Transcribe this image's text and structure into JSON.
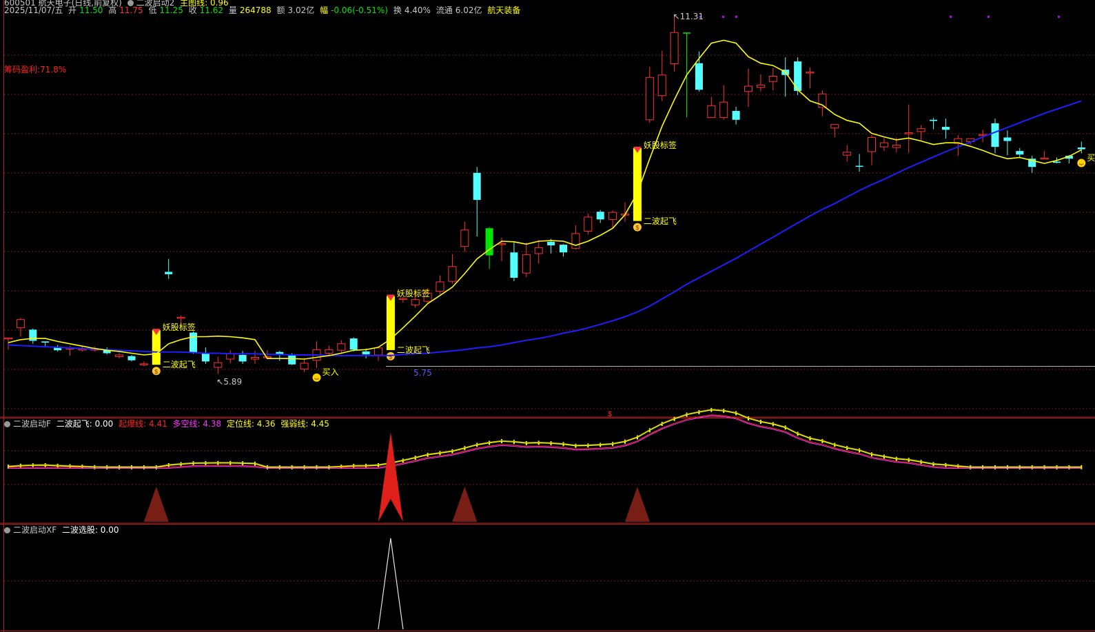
{
  "header": {
    "stock_code_name": "600501 航天电子(日线,前复权)",
    "indicator_name": "二波启动2",
    "guide_line": "主图线: 0.96",
    "date": "2025/11/07/五",
    "open_label": "开",
    "open": "11.50",
    "high_label": "高",
    "high": "11.75",
    "low_label": "低",
    "low": "11.25",
    "close_label": "收",
    "close": "11.62",
    "volume_label": "量",
    "volume": "264788",
    "amount_label": "额",
    "amount": "3.02亿",
    "change_label": "幅",
    "change": "-0.06(-0.51%)",
    "turnover_label": "换",
    "turnover": "4.40%",
    "float_label": "流通",
    "float_cap": "6.02亿",
    "sector": "航天装备"
  },
  "chip_profit": "筹码盈利:71.8%",
  "annotations": {
    "high_value": "11.31",
    "low_value": "5.89",
    "level_value": "5.75",
    "demon_tag": "妖股标签",
    "second_wave": "二波起飞",
    "buy": "买入",
    "buy_right": "买入"
  },
  "panel2": {
    "name": "二波启动F",
    "s1": "二波起飞: 0.00",
    "s2": "起爆线: 4.41",
    "s3": "多空线: 4.38",
    "s4": "定位线: 4.36",
    "s5": "强弱线: 4.45"
  },
  "panel3": {
    "name": "二波启动XF",
    "s1": "二波选股: 0.00"
  },
  "colors": {
    "up": "#ff3232",
    "down": "#54ffff",
    "signal": "#ffff00",
    "ma_fast": "#ffff00",
    "ma_slow": "#1e1eff",
    "limit_down": "#00e600",
    "grid": "#781e1e",
    "panel_border": "#b41e1e"
  },
  "chart_data": {
    "type": "candlestick",
    "candles": [
      [
        5.96,
        5.96,
        5.76,
        5.86
      ],
      [
        6.13,
        6.27,
        5.98,
        6.3
      ],
      [
        6.1,
        5.91,
        5.86,
        6.12
      ],
      [
        5.9,
        5.88,
        5.81,
        5.9
      ],
      [
        5.81,
        5.75,
        5.73,
        5.84
      ],
      [
        5.77,
        5.79,
        5.66,
        5.82
      ],
      [
        5.77,
        5.77,
        5.73,
        5.82
      ],
      [
        5.77,
        5.77,
        5.73,
        5.81
      ],
      [
        5.75,
        5.7,
        5.68,
        5.8
      ],
      [
        5.64,
        5.67,
        5.61,
        5.7
      ],
      [
        5.65,
        5.58,
        5.56,
        5.67
      ],
      [
        5.52,
        5.52,
        5.48,
        5.56
      ],
      [
        5.6,
        6.0,
        5.55,
        6.02
      ],
      [
        7.08,
        7.04,
        6.96,
        7.3
      ],
      [
        6.3,
        6.31,
        6.16,
        6.34
      ],
      [
        6.05,
        5.71,
        5.69,
        6.07
      ],
      [
        5.71,
        5.56,
        5.52,
        5.8
      ],
      [
        5.46,
        5.54,
        5.35,
        5.64
      ],
      [
        5.6,
        5.69,
        5.53,
        5.75
      ],
      [
        5.67,
        5.56,
        5.52,
        5.74
      ],
      [
        5.6,
        5.63,
        5.52,
        5.74
      ],
      [
        5.64,
        5.64,
        5.6,
        5.75
      ],
      [
        5.72,
        5.67,
        5.57,
        5.74
      ],
      [
        5.66,
        5.51,
        5.5,
        5.7
      ],
      [
        5.43,
        5.53,
        5.38,
        5.62
      ],
      [
        5.58,
        5.76,
        5.45,
        5.9
      ],
      [
        5.7,
        5.76,
        5.66,
        5.83
      ],
      [
        5.75,
        5.86,
        5.7,
        5.92
      ],
      [
        5.95,
        5.76,
        5.73,
        5.97
      ],
      [
        5.73,
        5.68,
        5.61,
        5.78
      ],
      [
        5.67,
        5.79,
        5.57,
        5.8
      ],
      [
        5.9,
        6.52,
        5.8,
        6.6
      ],
      [
        6.62,
        6.63,
        6.56,
        6.65
      ],
      [
        6.52,
        6.61,
        6.47,
        6.75
      ],
      [
        6.58,
        6.72,
        6.56,
        6.8
      ],
      [
        6.75,
        6.91,
        6.7,
        7.02
      ],
      [
        6.92,
        7.17,
        6.88,
        7.38
      ],
      [
        7.51,
        7.79,
        7.42,
        7.93
      ],
      [
        8.76,
        8.3,
        7.68,
        8.86
      ],
      [
        7.82,
        7.36,
        7.13,
        7.84
      ],
      [
        7.56,
        7.56,
        7.26,
        7.66
      ],
      [
        7.41,
        6.98,
        6.92,
        7.58
      ],
      [
        7.06,
        7.37,
        6.99,
        7.58
      ],
      [
        7.39,
        7.49,
        7.22,
        7.62
      ],
      [
        7.59,
        7.53,
        7.39,
        7.64
      ],
      [
        7.54,
        7.41,
        7.34,
        7.55
      ],
      [
        7.48,
        7.73,
        7.46,
        7.87
      ],
      [
        7.77,
        8.01,
        7.71,
        8.07
      ],
      [
        8.1,
        7.97,
        7.91,
        8.13
      ],
      [
        7.97,
        8.09,
        7.83,
        8.12
      ],
      [
        8.05,
        8.06,
        7.93,
        8.26
      ],
      [
        9.03,
        8.2,
        7.99,
        9.11
      ],
      [
        9.66,
        10.38,
        9.61,
        10.56
      ],
      [
        10.07,
        10.42,
        9.98,
        10.83
      ],
      [
        10.61,
        11.14,
        10.48,
        11.45
      ],
      [
        11.14,
        11.14,
        9.7,
        11.14
      ],
      [
        10.62,
        10.17,
        10.14,
        10.82
      ],
      [
        9.7,
        9.9,
        9.76,
        10.05
      ],
      [
        9.7,
        9.96,
        9.66,
        10.25
      ],
      [
        9.81,
        9.66,
        9.58,
        9.88
      ],
      [
        10.14,
        10.23,
        9.88,
        10.53
      ],
      [
        10.21,
        10.25,
        10.14,
        10.43
      ],
      [
        10.31,
        10.4,
        10.16,
        10.54
      ],
      [
        10.51,
        10.42,
        10.05,
        10.72
      ],
      [
        10.65,
        10.15,
        10.08,
        10.72
      ],
      [
        10.47,
        10.47,
        10.19,
        10.55
      ],
      [
        9.87,
        10.1,
        9.72,
        10.16
      ],
      [
        9.52,
        9.58,
        9.36,
        9.59
      ],
      [
        9.06,
        9.11,
        8.95,
        9.23
      ],
      [
        8.88,
        8.87,
        8.78,
        9.08
      ],
      [
        9.12,
        9.36,
        8.89,
        9.4
      ],
      [
        9.2,
        9.27,
        9.13,
        9.35
      ],
      [
        9.19,
        9.23,
        9.11,
        9.36
      ],
      [
        9.44,
        9.44,
        9.1,
        9.92
      ],
      [
        9.46,
        9.51,
        9.29,
        9.57
      ],
      [
        9.66,
        9.64,
        9.5,
        9.69
      ],
      [
        9.54,
        9.49,
        9.34,
        9.68
      ],
      [
        9.26,
        9.34,
        9.05,
        9.4
      ],
      [
        9.29,
        9.34,
        9.24,
        9.32
      ],
      [
        9.41,
        9.41,
        9.28,
        9.49
      ],
      [
        9.6,
        9.2,
        9.09,
        9.68
      ],
      [
        9.36,
        9.3,
        9.06,
        9.48
      ],
      [
        9.13,
        9.07,
        9.02,
        9.18
      ],
      [
        9.0,
        8.86,
        8.76,
        9.05
      ],
      [
        9.01,
        9.01,
        8.99,
        9.13
      ],
      [
        8.95,
        8.93,
        8.92,
        9.02
      ],
      [
        9.05,
        9.0,
        8.92,
        9.06
      ],
      [
        9.19,
        9.16,
        9.09,
        9.29
      ]
    ],
    "ma_fast_label": "MA5",
    "ma_slow_label": "MA60",
    "ma_fast": [
      5.88,
      5.93,
      5.95,
      5.95,
      5.9,
      5.86,
      5.82,
      5.78,
      5.75,
      5.73,
      5.7,
      5.67,
      5.69,
      5.86,
      5.93,
      5.98,
      5.98,
      5.99,
      5.98,
      5.96,
      5.93,
      5.61,
      5.61,
      5.61,
      5.6,
      5.63,
      5.66,
      5.7,
      5.75,
      5.76,
      5.8,
      5.94,
      6.13,
      6.33,
      6.54,
      6.68,
      6.82,
      7.05,
      7.3,
      7.46,
      7.6,
      7.59,
      7.55,
      7.6,
      7.61,
      7.6,
      7.53,
      7.6,
      7.7,
      7.82,
      8.05,
      8.42,
      9.0,
      9.55,
      10.0,
      10.42,
      10.7,
      10.96,
      11.01,
      10.96,
      10.73,
      10.62,
      10.58,
      10.47,
      10.17,
      9.98,
      9.91,
      9.75,
      9.65,
      9.6,
      9.43,
      9.37,
      9.32,
      9.35,
      9.3,
      9.24,
      9.27,
      9.27,
      9.21,
      9.14,
      9.06,
      9.0,
      9.02,
      8.97,
      8.92,
      8.97,
      9.04,
      9.15
    ],
    "ma_slow": [
      5.84,
      5.83,
      5.82,
      5.81,
      5.8,
      5.79,
      5.78,
      5.77,
      5.76,
      5.75,
      5.74,
      5.73,
      5.72,
      5.72,
      5.72,
      5.71,
      5.7,
      5.7,
      5.69,
      5.69,
      5.69,
      5.68,
      5.68,
      5.67,
      5.67,
      5.67,
      5.66,
      5.66,
      5.66,
      5.66,
      5.66,
      5.66,
      5.68,
      5.69,
      5.7,
      5.72,
      5.74,
      5.76,
      5.79,
      5.81,
      5.84,
      5.88,
      5.92,
      5.95,
      5.99,
      6.04,
      6.08,
      6.13,
      6.19,
      6.25,
      6.32,
      6.4,
      6.5,
      6.62,
      6.74,
      6.87,
      6.98,
      7.09,
      7.2,
      7.31,
      7.43,
      7.55,
      7.67,
      7.79,
      7.91,
      8.03,
      8.14,
      8.24,
      8.35,
      8.46,
      8.56,
      8.65,
      8.75,
      8.85,
      8.94,
      9.03,
      9.12,
      9.2,
      9.28,
      9.37,
      9.45,
      9.53,
      9.61,
      9.69,
      9.77,
      9.84,
      9.91,
      9.98
    ],
    "demon_signal_bars": [
      12,
      31,
      51
    ],
    "buy_bars": [
      25,
      87
    ],
    "low_bar": 17,
    "high_bar": 54,
    "ylim": [
      4.7,
      11.4
    ],
    "osc_spikes": [
      12,
      31,
      37,
      51
    ],
    "osc_main_spike": 31,
    "select_spike": 31
  }
}
